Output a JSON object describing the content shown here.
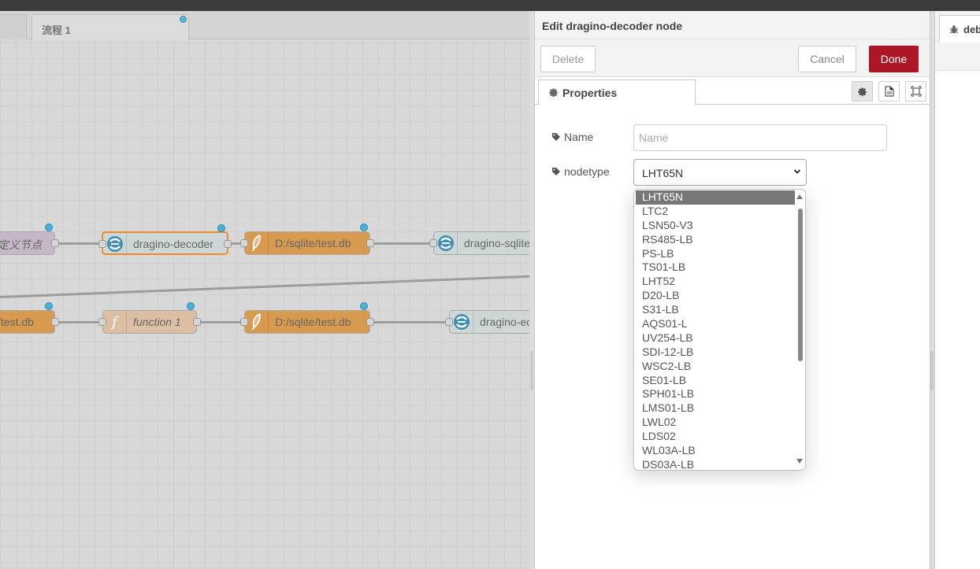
{
  "workspace": {
    "flow_tab": "流程 1",
    "nodes": [
      {
        "label": "定义节点"
      },
      {
        "label": "dragino-decoder"
      },
      {
        "label": "D:/sqlite/test.db"
      },
      {
        "label": "dragino-sqlite"
      },
      {
        "label": "/test.db"
      },
      {
        "label": "function 1"
      },
      {
        "label": "D:/sqlite/test.db"
      },
      {
        "label": "dragino-ec"
      }
    ]
  },
  "panel": {
    "title": "Edit dragino-decoder node",
    "delete_label": "Delete",
    "cancel_label": "Cancel",
    "done_label": "Done",
    "properties_tab": "Properties",
    "name_label": "Name",
    "name_placeholder": "Name",
    "nodetype_label": "nodetype",
    "nodetype_value": "LHT65N",
    "options": [
      {
        "label": "LHT65N"
      },
      {
        "label": "LTC2"
      },
      {
        "label": "LSN50-V3"
      },
      {
        "label": "RS485-LB"
      },
      {
        "label": "PS-LB"
      },
      {
        "label": "TS01-LB"
      },
      {
        "label": "LHT52"
      },
      {
        "label": "D20-LB"
      },
      {
        "label": "S31-LB"
      },
      {
        "label": "AQS01-L"
      },
      {
        "label": "UV254-LB"
      },
      {
        "label": "SDI-12-LB"
      },
      {
        "label": "WSC2-LB"
      },
      {
        "label": "SE01-LB"
      },
      {
        "label": "SPH01-LB"
      },
      {
        "label": "LMS01-LB"
      },
      {
        "label": "LWL02"
      },
      {
        "label": "LDS02"
      },
      {
        "label": "WL03A-LB"
      },
      {
        "label": "DS03A-LB"
      }
    ]
  },
  "sidebar": {
    "tab_label": "debug"
  },
  "colors": {
    "done_button": "#ad1625",
    "status_dot": "#4ab0d9",
    "selection_outline": "#ee8a2e",
    "storage_node": "#d89a4f"
  }
}
